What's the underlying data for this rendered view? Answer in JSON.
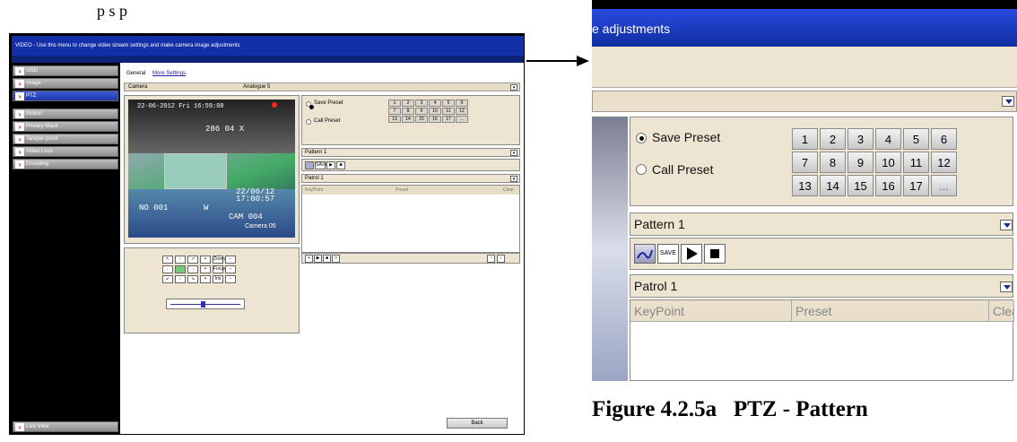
{
  "page_header_fragment": "p   s            p",
  "window": {
    "title": "VIDEO - Use this menu to change video stream settings and make camera image adjustments"
  },
  "sidebar": {
    "items": [
      {
        "label": "OSD"
      },
      {
        "label": "Image"
      },
      {
        "label": "PTZ",
        "active": true
      },
      {
        "label": "Motion"
      },
      {
        "label": "Privacy Mask"
      },
      {
        "label": "Tamper-proof"
      },
      {
        "label": "Video Loss"
      },
      {
        "label": "Encoding"
      }
    ],
    "live_view": "Live View"
  },
  "tabs": {
    "general": "General",
    "more": "More Settings"
  },
  "camera": {
    "label": "Camera",
    "value": "Analogue 5"
  },
  "video": {
    "timestamp": "22-06-2012 Fri 16:59:08",
    "zoom_text": "286  04 X",
    "overlay_date": "22/06/12",
    "overlay_time": "17:00:57",
    "channel": "NO 001",
    "dir": "W",
    "cam": "CAM 004",
    "camera_label": "Camera 05"
  },
  "presets": {
    "save": "Save Preset",
    "call": "Call Preset",
    "buttons": [
      "1",
      "2",
      "3",
      "4",
      "5",
      "6",
      "7",
      "8",
      "9",
      "10",
      "11",
      "12",
      "13",
      "14",
      "15",
      "16",
      "17",
      "..."
    ]
  },
  "pattern": {
    "label": "Pattern 1",
    "save": "SAVE"
  },
  "patrol": {
    "label": "Patrol 1",
    "columns": [
      "KeyPoint",
      "Preset",
      "Clear"
    ]
  },
  "ptz_controls": {
    "zoom": "Zoom",
    "focus": "Focus",
    "iris": "Iris"
  },
  "back_button": "Back",
  "zoom_header": "e adjustments",
  "caption": "Figure 4.2.5a   PTZ - Pattern",
  "colors": {
    "title_blue": "#1430a8",
    "beige": "#eee4d2",
    "active_blue": "#2a4be0"
  }
}
